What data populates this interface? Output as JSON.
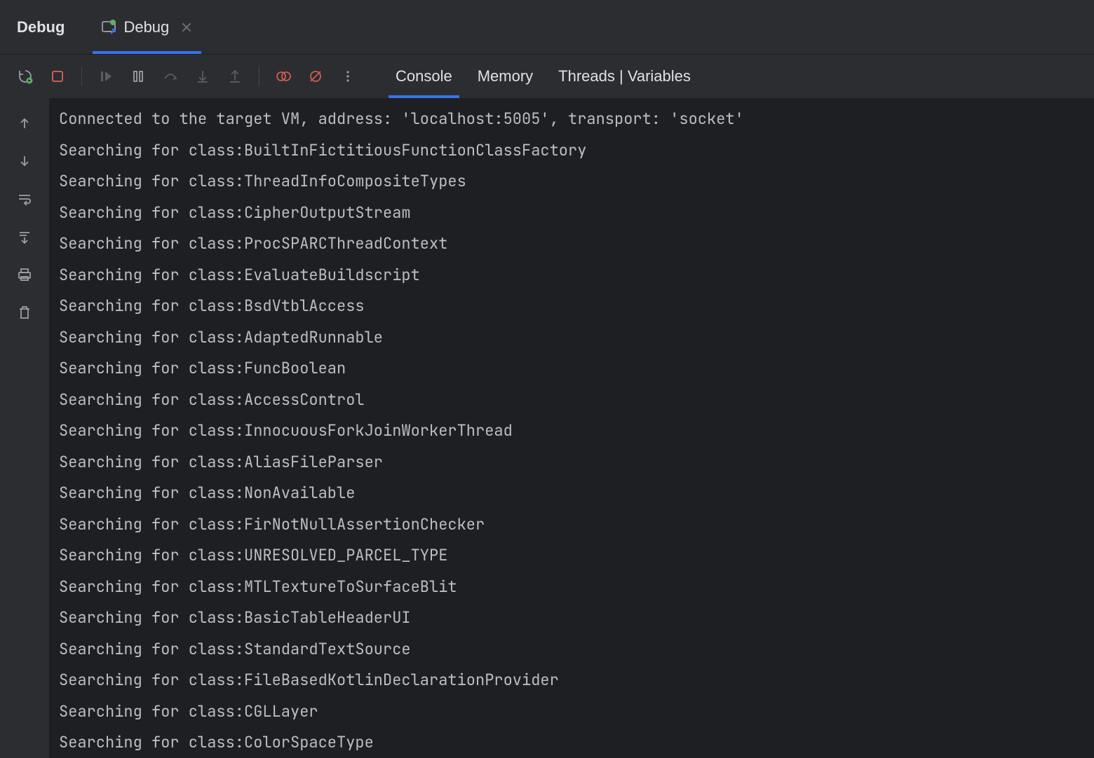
{
  "header": {
    "title": "Debug",
    "tab_label": "Debug"
  },
  "toolbar_tabs": {
    "console": "Console",
    "memory": "Memory",
    "threads": "Threads | Variables"
  },
  "console_lines": [
    "Connected to the target VM, address: 'localhost:5005', transport: 'socket'",
    "Searching for class:BuiltInFictitiousFunctionClassFactory",
    "Searching for class:ThreadInfoCompositeTypes",
    "Searching for class:CipherOutputStream",
    "Searching for class:ProcSPARCThreadContext",
    "Searching for class:EvaluateBuildscript",
    "Searching for class:BsdVtblAccess",
    "Searching for class:AdaptedRunnable",
    "Searching for class:FuncBoolean",
    "Searching for class:AccessControl",
    "Searching for class:InnocuousForkJoinWorkerThread",
    "Searching for class:AliasFileParser",
    "Searching for class:NonAvailable",
    "Searching for class:FirNotNullAssertionChecker",
    "Searching for class:UNRESOLVED_PARCEL_TYPE",
    "Searching for class:MTLTextureToSurfaceBlit",
    "Searching for class:BasicTableHeaderUI",
    "Searching for class:StandardTextSource",
    "Searching for class:FileBasedKotlinDeclarationProvider",
    "Searching for class:CGLLayer",
    "Searching for class:ColorSpaceType"
  ]
}
